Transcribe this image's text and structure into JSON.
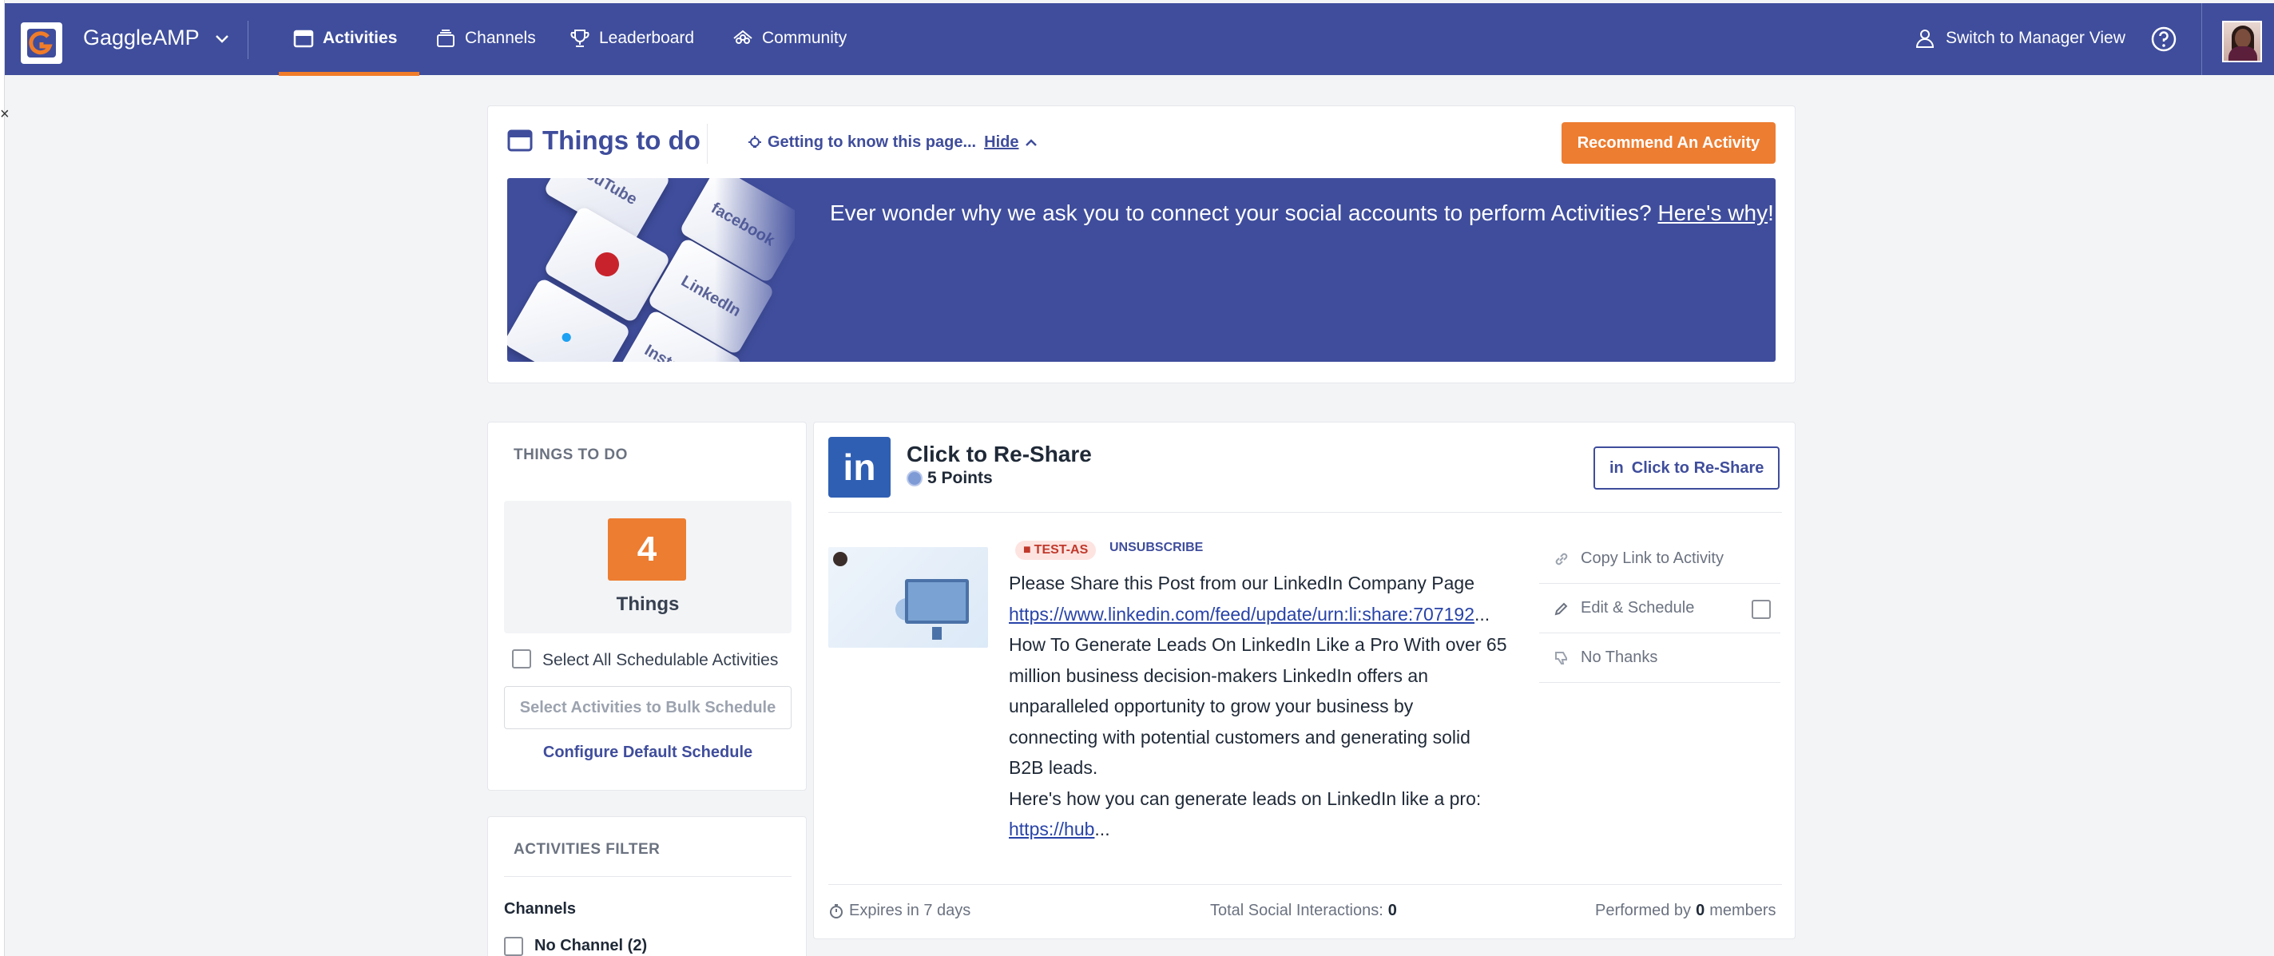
{
  "nav": {
    "brand": "GaggleAMP",
    "items": [
      {
        "label": "Activities",
        "icon": "calendar-icon",
        "active": true
      },
      {
        "label": "Channels",
        "icon": "stack-icon",
        "active": false
      },
      {
        "label": "Leaderboard",
        "icon": "trophy-icon",
        "active": false
      },
      {
        "label": "Community",
        "icon": "community-icon",
        "active": false
      }
    ],
    "manager_view": "Switch to Manager View",
    "accent": "#f07c29",
    "bg": "#3f4d9c"
  },
  "todo": {
    "title": "Things to do",
    "getting_to_know": "Getting to know this page...",
    "hide": "Hide",
    "recommend": "Recommend An Activity",
    "banner_text": "Ever wonder why we ask you to connect your social accounts to perform Activities?",
    "banner_link": "Here's why",
    "banner_suffix": "!",
    "tiles": [
      "YouTube",
      "facebook",
      "LinkedIn",
      "Instagram"
    ]
  },
  "left": {
    "section_label": "THINGS TO DO",
    "count": "4",
    "count_label": "Things",
    "select_all": "Select All Schedulable Activities",
    "bulk_schedule": "Select Activities to Bulk Schedule",
    "configure": "Configure Default Schedule"
  },
  "filter": {
    "section_label": "ACTIVITIES FILTER",
    "channels_label": "Channels",
    "no_channel": "No Channel (2)"
  },
  "activity": {
    "logo": "in",
    "title": "Click to Re-Share",
    "points": "5 Points",
    "button": "Click to Re-Share",
    "tag": "TEST-AS",
    "unsubscribe": "UNSUBSCRIBE",
    "line1": "Please Share this Post from our LinkedIn Company Page",
    "link1": "https://www.linkedin.com/feed/update/urn:li:share:707192",
    "ellipsis": "...",
    "body_lines": [
      "How To Generate Leads On LinkedIn Like a Pro With over 65",
      "million business decision-makers LinkedIn offers an",
      "unparalleled opportunity to grow your business by",
      "connecting with potential customers and generating solid",
      "B2B leads.",
      "Here's how you can generate leads on LinkedIn like a pro:"
    ],
    "link2": "https://hub",
    "ellipsis2": "...",
    "side_actions": {
      "copy_link": "Copy Link to Activity",
      "edit_schedule": "Edit & Schedule",
      "no_thanks": "No Thanks"
    },
    "footer": {
      "expires": "Expires in 7 days",
      "interactions_label": "Total Social Interactions:",
      "interactions_value": "0",
      "performed_prefix": "Performed by",
      "performed_value": "0",
      "performed_suffix": "members"
    }
  }
}
